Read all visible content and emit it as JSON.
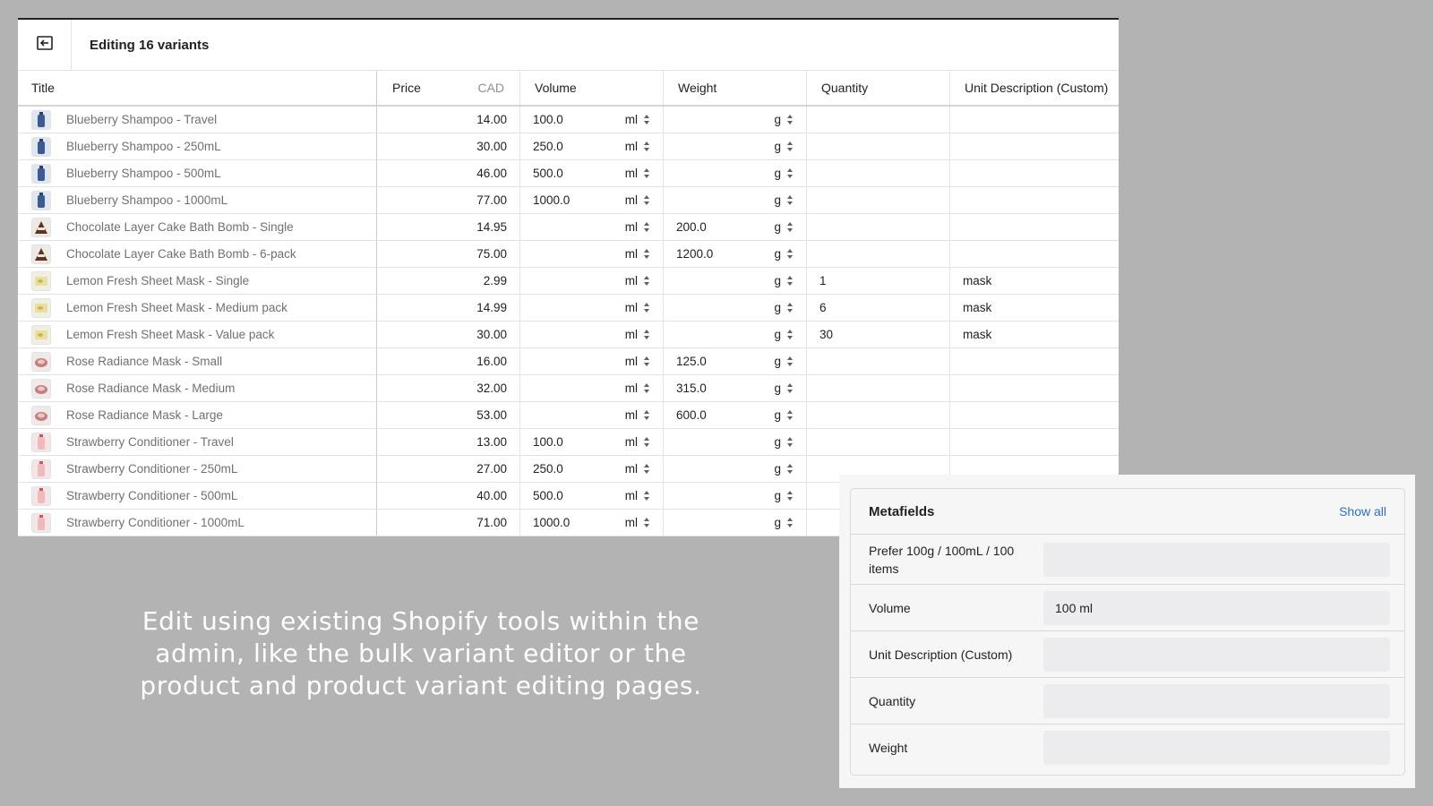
{
  "editor": {
    "title": "Editing 16 variants",
    "columns": {
      "title": "Title",
      "price": "Price",
      "currency": "CAD",
      "volume": "Volume",
      "weight": "Weight",
      "quantity": "Quantity",
      "unit_description": "Unit Description (Custom)"
    },
    "rows": [
      {
        "title": "Blueberry Shampoo - Travel",
        "thumb": "blue",
        "price": "14.00",
        "volume": "100.0",
        "volume_unit": "ml",
        "weight": "",
        "weight_unit": "g",
        "quantity": "",
        "unit_description": ""
      },
      {
        "title": "Blueberry Shampoo - 250mL",
        "thumb": "blue",
        "price": "30.00",
        "volume": "250.0",
        "volume_unit": "ml",
        "weight": "",
        "weight_unit": "g",
        "quantity": "",
        "unit_description": ""
      },
      {
        "title": "Blueberry Shampoo - 500mL",
        "thumb": "blue",
        "price": "46.00",
        "volume": "500.0",
        "volume_unit": "ml",
        "weight": "",
        "weight_unit": "g",
        "quantity": "",
        "unit_description": ""
      },
      {
        "title": "Blueberry Shampoo - 1000mL",
        "thumb": "blue",
        "price": "77.00",
        "volume": "1000.0",
        "volume_unit": "ml",
        "weight": "",
        "weight_unit": "g",
        "quantity": "",
        "unit_description": ""
      },
      {
        "title": "Chocolate Layer Cake Bath Bomb - Single",
        "thumb": "choc",
        "price": "14.95",
        "volume": "",
        "volume_unit": "ml",
        "weight": "200.0",
        "weight_unit": "g",
        "quantity": "",
        "unit_description": ""
      },
      {
        "title": "Chocolate Layer Cake Bath Bomb - 6-pack",
        "thumb": "choc",
        "price": "75.00",
        "volume": "",
        "volume_unit": "ml",
        "weight": "1200.0",
        "weight_unit": "g",
        "quantity": "",
        "unit_description": ""
      },
      {
        "title": "Lemon Fresh Sheet Mask - Single",
        "thumb": "lemon",
        "price": "2.99",
        "volume": "",
        "volume_unit": "ml",
        "weight": "",
        "weight_unit": "g",
        "quantity": "1",
        "unit_description": "mask"
      },
      {
        "title": "Lemon Fresh Sheet Mask - Medium pack",
        "thumb": "lemon",
        "price": "14.99",
        "volume": "",
        "volume_unit": "ml",
        "weight": "",
        "weight_unit": "g",
        "quantity": "6",
        "unit_description": "mask"
      },
      {
        "title": "Lemon Fresh Sheet Mask - Value pack",
        "thumb": "lemon",
        "price": "30.00",
        "volume": "",
        "volume_unit": "ml",
        "weight": "",
        "weight_unit": "g",
        "quantity": "30",
        "unit_description": "mask"
      },
      {
        "title": "Rose Radiance Mask - Small",
        "thumb": "rose",
        "price": "16.00",
        "volume": "",
        "volume_unit": "ml",
        "weight": "125.0",
        "weight_unit": "g",
        "quantity": "",
        "unit_description": ""
      },
      {
        "title": "Rose Radiance Mask - Medium",
        "thumb": "rose",
        "price": "32.00",
        "volume": "",
        "volume_unit": "ml",
        "weight": "315.0",
        "weight_unit": "g",
        "quantity": "",
        "unit_description": ""
      },
      {
        "title": "Rose Radiance Mask - Large",
        "thumb": "rose",
        "price": "53.00",
        "volume": "",
        "volume_unit": "ml",
        "weight": "600.0",
        "weight_unit": "g",
        "quantity": "",
        "unit_description": ""
      },
      {
        "title": "Strawberry Conditioner - Travel",
        "thumb": "straw",
        "price": "13.00",
        "volume": "100.0",
        "volume_unit": "ml",
        "weight": "",
        "weight_unit": "g",
        "quantity": "",
        "unit_description": ""
      },
      {
        "title": "Strawberry Conditioner - 250mL",
        "thumb": "straw",
        "price": "27.00",
        "volume": "250.0",
        "volume_unit": "ml",
        "weight": "",
        "weight_unit": "g",
        "quantity": "",
        "unit_description": ""
      },
      {
        "title": "Strawberry Conditioner - 500mL",
        "thumb": "straw",
        "price": "40.00",
        "volume": "500.0",
        "volume_unit": "ml",
        "weight": "",
        "weight_unit": "g",
        "quantity": "",
        "unit_description": ""
      },
      {
        "title": "Strawberry Conditioner - 1000mL",
        "thumb": "straw",
        "price": "71.00",
        "volume": "1000.0",
        "volume_unit": "ml",
        "weight": "",
        "weight_unit": "g",
        "quantity": "",
        "unit_description": ""
      }
    ]
  },
  "caption": "Edit using existing Shopify tools within the admin, like the bulk variant editor or the product and product variant editing pages.",
  "metafields": {
    "title": "Metafields",
    "show_all": "Show all",
    "fields": [
      {
        "label": "Prefer 100g / 100mL / 100 items",
        "value": ""
      },
      {
        "label": "Volume",
        "value": "100 ml"
      },
      {
        "label": "Unit Description (Custom)",
        "value": ""
      },
      {
        "label": "Quantity",
        "value": ""
      },
      {
        "label": "Weight",
        "value": ""
      }
    ]
  },
  "colors": {
    "background": "#b3b3b3",
    "link": "#2c6ecb",
    "muted_text": "#6d7175"
  }
}
